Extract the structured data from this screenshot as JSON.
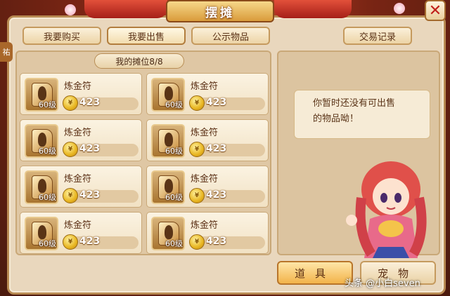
{
  "header": {
    "title": "摆摊",
    "close_symbol": "✕"
  },
  "tabs": [
    {
      "label": "我要购买",
      "active": false
    },
    {
      "label": "我要出售",
      "active": true
    },
    {
      "label": "公示物品",
      "active": false
    }
  ],
  "trade_record_label": "交易记录",
  "side_tag": "祐",
  "stall": {
    "header": "我的摊位8/8",
    "items": [
      {
        "name": "炼金符",
        "level": "60级",
        "price": "423"
      },
      {
        "name": "炼金符",
        "level": "60级",
        "price": "423"
      },
      {
        "name": "炼金符",
        "level": "60级",
        "price": "423"
      },
      {
        "name": "炼金符",
        "level": "60级",
        "price": "423"
      },
      {
        "name": "炼金符",
        "level": "60级",
        "price": "423"
      },
      {
        "name": "炼金符",
        "level": "60级",
        "price": "423"
      },
      {
        "name": "炼金符",
        "level": "60级",
        "price": "423"
      },
      {
        "name": "炼金符",
        "level": "60级",
        "price": "423"
      }
    ]
  },
  "message": {
    "line1": "你暂时还没有可出售",
    "line2": "的物品呦！"
  },
  "bottom_tabs": [
    {
      "label": "道具",
      "active": true
    },
    {
      "label": "宠物",
      "active": false
    }
  ],
  "watermark": "头条 @小白seven",
  "colors": {
    "accent_red": "#c0201a",
    "panel_bg": "#e9d7bd",
    "gold": "#e8b520"
  }
}
